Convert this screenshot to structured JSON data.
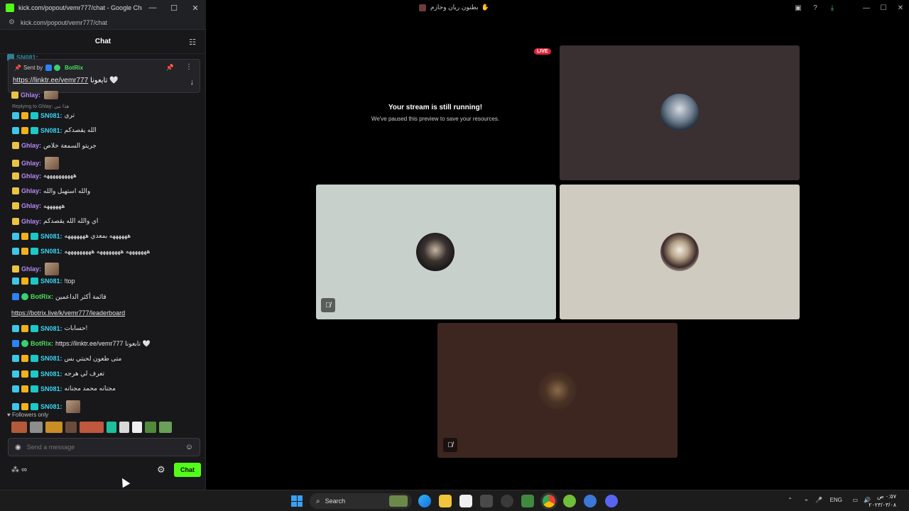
{
  "popout": {
    "window_title": "kick.com/popout/vemr777/chat - Google Chro...",
    "url": "kick.com/popout/vemr777/chat",
    "chat_title": "Chat",
    "pinned": {
      "sent_by": "Sent by",
      "bot_name": "BotRix",
      "link": "https://linktr.ee/vemr777",
      "text": "تابعونا",
      "heart": "🤍"
    },
    "reply_hint": "Replying to Ghlay: هذا تبي",
    "messages": [
      {
        "user": "SN081:",
        "text": "تري",
        "type": "sub"
      },
      {
        "user": "SN081:",
        "text": "الله يقصدكم",
        "type": "sub"
      },
      {
        "user": "Ghlay:",
        "text": "جريتو السمعة خلاص",
        "type": "ghlay"
      },
      {
        "user": "Ghlay:",
        "text": "",
        "type": "ghlay-emote"
      },
      {
        "user": "Ghlay:",
        "text": "ههههههههههه",
        "type": "ghlay"
      },
      {
        "user": "Ghlay:",
        "text": "والله استهبل والله",
        "type": "ghlay"
      },
      {
        "user": "Ghlay:",
        "text": "ههههههه",
        "type": "ghlay"
      },
      {
        "user": "Ghlay:",
        "text": "اي والله الله يقصدكم",
        "type": "ghlay"
      },
      {
        "user": "SN081:",
        "text": "ههههههه بمعدي هههههههه",
        "type": "sub"
      },
      {
        "user": "SN081:",
        "text": "هههههههه ههههههههه هههههههههه",
        "type": "sub"
      },
      {
        "user": "Ghlay:",
        "text": "",
        "type": "ghlay-emote"
      },
      {
        "user": "SN081:",
        "text": "!top",
        "type": "sub"
      },
      {
        "user": "BotRix:",
        "text": "قائمة أكثر الداعمين",
        "type": "bot"
      },
      {
        "user": "",
        "text": "https://botrix.live/k/vemr777/leaderboard",
        "type": "link"
      },
      {
        "user": "SN081:",
        "text": "حسابات!",
        "type": "sub"
      },
      {
        "user": "BotRix:",
        "text": "https://linktr.ee/vemr777 تابعونا 🤍",
        "type": "bot"
      },
      {
        "user": "SN081:",
        "text": "متى طعون لحبتي بس",
        "type": "sub"
      },
      {
        "user": "SN081:",
        "text": "تعرف لي هرجه",
        "type": "sub"
      },
      {
        "user": "SN081:",
        "text": "مجنانه محمد مجنانه",
        "type": "sub"
      },
      {
        "user": "SN081:",
        "text": "",
        "type": "sub-emote"
      }
    ],
    "followers_only": "Followers only",
    "input_placeholder": "Send a message",
    "points": "∞",
    "send_label": "Chat"
  },
  "main": {
    "window_title": "بطنون ريان وحازم",
    "live_label": "LIVE",
    "paused_heading": "Your stream is still running!",
    "paused_sub": "We've paused this preview to save your resources."
  },
  "taskbar": {
    "search_label": "Search",
    "lang": "ENG",
    "time": "٠:٥٧ ص",
    "date": "٢٠٢٣/٠٣/٠٨"
  },
  "colors": {
    "kick_green": "#53fc18",
    "live_red": "#e0253b",
    "ghlay_purple": "#b58cf5",
    "sub_cyan": "#3cd4f2"
  }
}
